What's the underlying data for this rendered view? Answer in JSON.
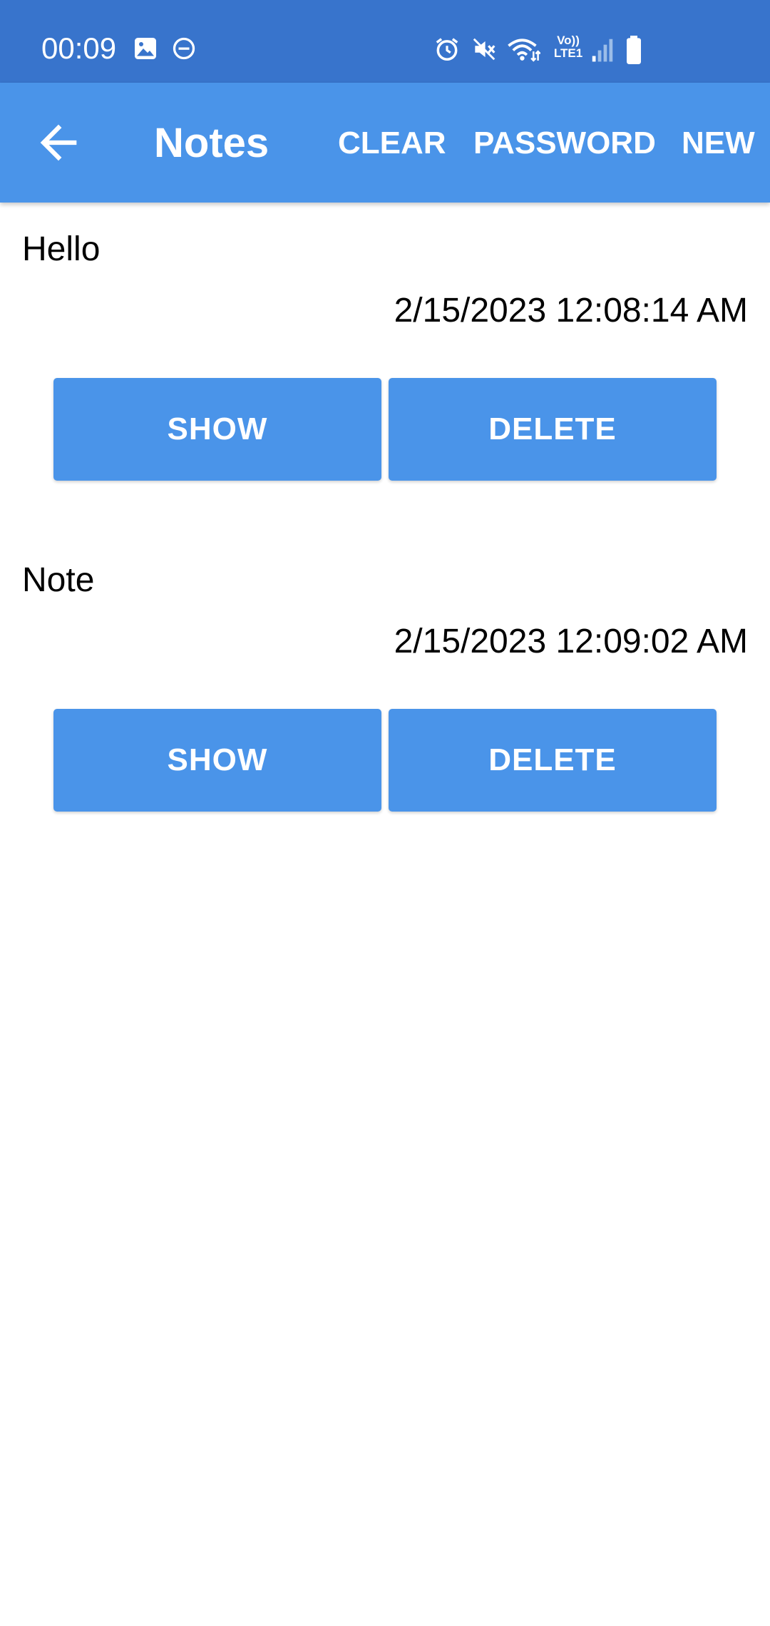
{
  "status_bar": {
    "time": "00:09",
    "network_label_top": "Vo))",
    "network_label_bottom": "LTE1",
    "icons": [
      "gallery-icon",
      "do-not-disturb-icon",
      "alarm-icon",
      "mute-icon",
      "wifi-icon",
      "volte-lte-icon",
      "signal-icon",
      "battery-icon"
    ]
  },
  "app_bar": {
    "title": "Notes",
    "actions": {
      "clear": "CLEAR",
      "password": "PASSWORD",
      "new": "NEW"
    }
  },
  "notes": [
    {
      "title": "Hello",
      "date": "2/15/2023 12:08:14 AM",
      "show_label": "SHOW",
      "delete_label": "DELETE"
    },
    {
      "title": "Note",
      "date": "2/15/2023 12:09:02 AM",
      "show_label": "SHOW",
      "delete_label": "DELETE"
    }
  ],
  "colors": {
    "status_bar": "#3874cc",
    "app_bar": "#4a94e9",
    "button": "#4a94e9",
    "button_text": "#ffffff",
    "text": "#000000"
  }
}
